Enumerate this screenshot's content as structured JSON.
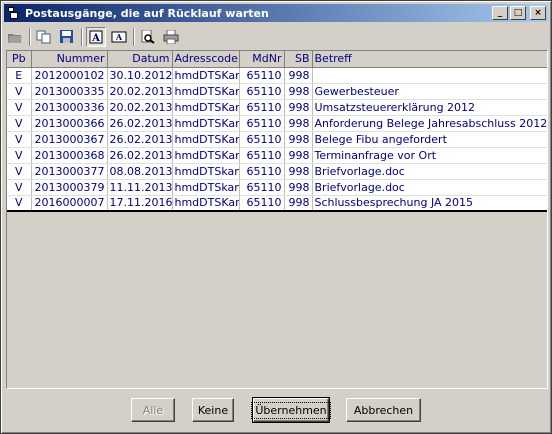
{
  "window": {
    "title": "Postausgänge, die auf Rücklauf warten",
    "controls": {
      "minimize": "_",
      "maximize": "□",
      "close": "×"
    }
  },
  "toolbar": {
    "icons": [
      "folder-open-icon",
      "copy-icon",
      "save-icon",
      "text-a-icon",
      "text-ab-icon",
      "print-preview-icon",
      "print-icon"
    ]
  },
  "table": {
    "columns": [
      "Pb",
      "Nummer",
      "Datum",
      "Adresscode",
      "MdNr",
      "SB",
      "Betreff"
    ],
    "rows": [
      [
        "E",
        "2012000102",
        "30.10.2012",
        "hmdDTSKanz",
        "65110",
        "998",
        ""
      ],
      [
        "V",
        "2013000335",
        "20.02.2013",
        "hmdDTSKanz",
        "65110",
        "998",
        "Gewerbesteuer"
      ],
      [
        "V",
        "2013000336",
        "20.02.2013",
        "hmdDTSKanz",
        "65110",
        "998",
        "Umsatzsteuererklärung 2012"
      ],
      [
        "V",
        "2013000366",
        "26.02.2013",
        "hmdDTSKanz",
        "65110",
        "998",
        "Anforderung Belege Jahresabschluss 2012"
      ],
      [
        "V",
        "2013000367",
        "26.02.2013",
        "hmdDTSKanz",
        "65110",
        "998",
        "Belege Fibu angefordert"
      ],
      [
        "V",
        "2013000368",
        "26.02.2013",
        "hmdDTSKanz",
        "65110",
        "998",
        "Terminanfrage vor Ort"
      ],
      [
        "V",
        "2013000377",
        "08.08.2013",
        "hmdDTSkanzl",
        "65110",
        "998",
        "Briefvorlage.doc"
      ],
      [
        "V",
        "2013000379",
        "11.11.2013",
        "hmdDTSkanzl",
        "65110",
        "998",
        "Briefvorlage.doc"
      ],
      [
        "V",
        "2016000007",
        "17.11.2016",
        "hmdDTSKanz",
        "65110",
        "998",
        "Schlussbesprechung JA 2015"
      ]
    ]
  },
  "buttons": {
    "all": "Alle",
    "none": "Keine",
    "accept": "Übernehmen",
    "cancel": "Abbrechen"
  },
  "colors": {
    "title_start": "#0a246a",
    "title_end": "#a6caf0",
    "cell_text": "#000080"
  }
}
